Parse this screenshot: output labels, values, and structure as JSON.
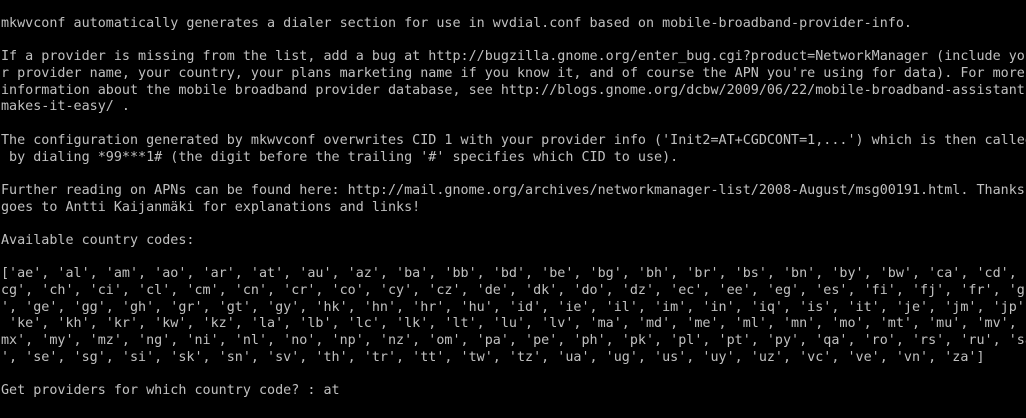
{
  "terminal": {
    "lines": [
      "mkwvconf automatically generates a dialer section for use in wvdial.conf based on mobile-broadband-provider-info.",
      "",
      "If a provider is missing from the list, add a bug at http://bugzilla.gnome.org/enter_bug.cgi?product=NetworkManager (include you",
      "r provider name, your country, your plans marketing name if you know it, and of course the APN you're using for data). For more",
      "information about the mobile broadband provider database, see http://blogs.gnome.org/dcbw/2009/06/22/mobile-broadband-assistant-",
      "makes-it-easy/ .",
      "",
      "The configuration generated by mkwvconf overwrites CID 1 with your provider info ('Init2=AT+CGDCONT=1,...') which is then called",
      " by dialing *99***1# (the digit before the trailing '#' specifies which CID to use).",
      "",
      "Further reading on APNs can be found here: http://mail.gnome.org/archives/networkmanager-list/2008-August/msg00191.html. Thanks",
      "goes to Antti Kaijanmäki for explanations and links!",
      "",
      "Available country codes:",
      "",
      "['ae', 'al', 'am', 'ao', 'ar', 'at', 'au', 'az', 'ba', 'bb', 'bd', 'be', 'bg', 'bh', 'br', 'bs', 'bn', 'by', 'bw', 'ca', 'cd', '",
      "cg', 'ch', 'ci', 'cl', 'cm', 'cn', 'cr', 'co', 'cy', 'cz', 'de', 'dk', 'do', 'dz', 'ec', 'ee', 'eg', 'es', 'fi', 'fj', 'fr', 'gb",
      "', 'ge', 'gg', 'gh', 'gr', 'gt', 'gy', 'hk', 'hn', 'hr', 'hu', 'id', 'ie', 'il', 'im', 'in', 'iq', 'is', 'it', 'je', 'jm', 'jp',",
      " 'ke', 'kh', 'kr', 'kw', 'kz', 'la', 'lb', 'lc', 'lk', 'lt', 'lu', 'lv', 'ma', 'md', 'me', 'ml', 'mn', 'mo', 'mt', 'mu', 'mv', '",
      "mx', 'my', 'mz', 'ng', 'ni', 'nl', 'no', 'np', 'nz', 'om', 'pa', 'pe', 'ph', 'pk', 'pl', 'pt', 'py', 'qa', 'ro', 'rs', 'ru', 'sa",
      "', 'se', 'sg', 'si', 'sk', 'sn', 'sv', 'th', 'tr', 'tt', 'tw', 'tz', 'ua', 'ug', 'us', 'uy', 'uz', 'vc', 've', 'vn', 'za']",
      ""
    ],
    "prompt_text": "Get providers for which country code? : ",
    "prompt_input_value": "at"
  }
}
